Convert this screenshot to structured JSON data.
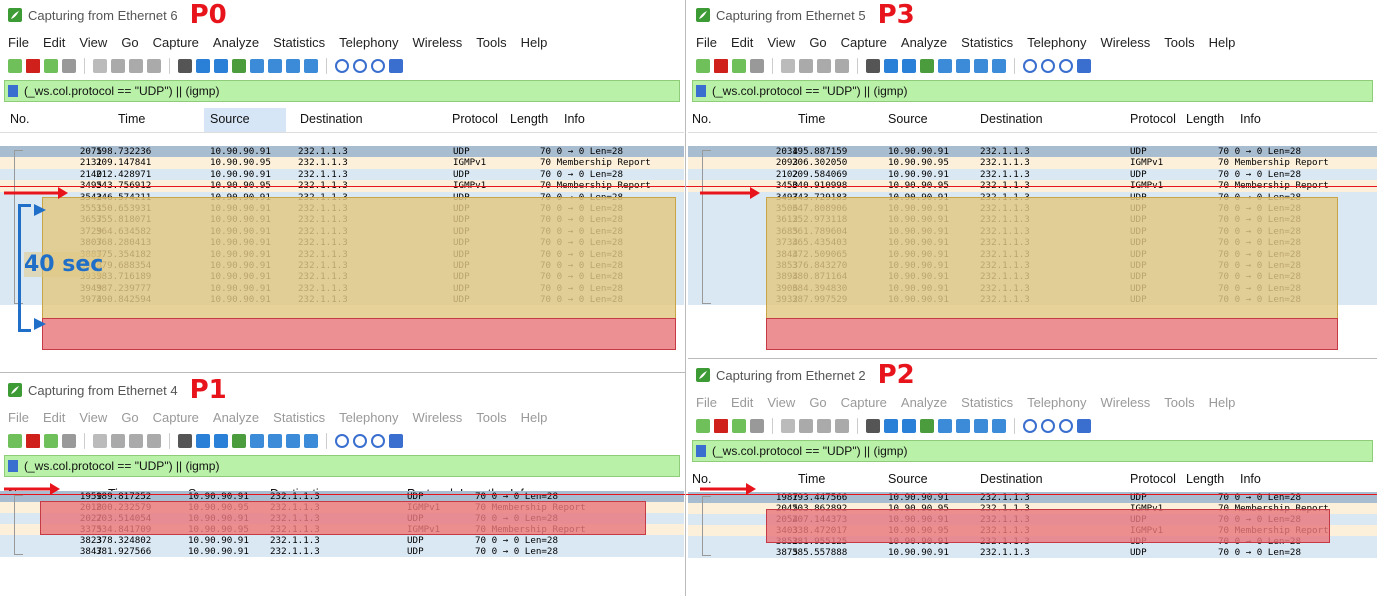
{
  "colors": {
    "filter_bg": "#b9f1a8",
    "udp_row": "#dae8f4",
    "igmp_row": "#fdf0da",
    "highlight_red": "#e97a7d",
    "highlight_yellow": "#e2c882",
    "accent_red": "#e8141c",
    "accent_blue": "#1f6ec8"
  },
  "menu": [
    "File",
    "Edit",
    "View",
    "Go",
    "Capture",
    "Analyze",
    "Statistics",
    "Telephony",
    "Wireless",
    "Tools",
    "Help"
  ],
  "filter": "(_ws.col.protocol == \"UDP\") || (igmp)",
  "columns": {
    "no": "No.",
    "time": "Time",
    "source": "Source",
    "destination": "Destination",
    "protocol": "Protocol",
    "length": "Length",
    "info": "Info"
  },
  "annotation_40sec": "40 sec",
  "panes": {
    "p0": {
      "title": "Capturing from Ethernet 6",
      "tag": "P0",
      "rows": [
        [
          "2075",
          "198.732236",
          "10.90.90.91",
          "232.1.1.3",
          "UDP",
          "70 0 → 0 Len=28"
        ],
        [
          "2131",
          "209.147841",
          "10.90.90.95",
          "232.1.1.3",
          "IGMPv1",
          "70 Membership Report"
        ],
        [
          "2140",
          "212.428971",
          "10.90.90.91",
          "232.1.1.3",
          "UDP",
          "70 0 → 0 Len=28"
        ],
        [
          "3495",
          "343.756912",
          "10.90.90.95",
          "232.1.1.3",
          "IGMPv1",
          "70 Membership Report"
        ],
        [
          "3542",
          "346.574211",
          "10.90.90.91",
          "232.1.1.3",
          "UDP",
          "70 0 → 0 Len=28"
        ],
        [
          "3551",
          "350.653931",
          "10.90.90.91",
          "232.1.1.3",
          "UDP",
          "70 0 → 0 Len=28"
        ],
        [
          "3657",
          "355.818071",
          "10.90.90.91",
          "232.1.1.3",
          "UDP",
          "70 0 → 0 Len=28"
        ],
        [
          "3729",
          "364.634582",
          "10.90.90.91",
          "232.1.1.3",
          "UDP",
          "70 0 → 0 Len=28"
        ],
        [
          "3807",
          "368.280413",
          "10.90.90.91",
          "232.1.1.3",
          "UDP",
          "70 0 → 0 Len=28"
        ],
        [
          "3887",
          "375.354182",
          "10.90.90.91",
          "232.1.1.3",
          "UDP",
          "70 0 → 0 Len=28"
        ],
        [
          "3898",
          "379.688354",
          "10.90.90.91",
          "232.1.1.3",
          "UDP",
          "70 0 → 0 Len=28"
        ],
        [
          "3939",
          "383.716189",
          "10.90.90.91",
          "232.1.1.3",
          "UDP",
          "70 0 → 0 Len=28"
        ],
        [
          "3949",
          "387.239777",
          "10.90.90.91",
          "232.1.1.3",
          "UDP",
          "70 0 → 0 Len=28"
        ],
        [
          "3974",
          "390.842594",
          "10.90.90.91",
          "232.1.1.3",
          "UDP",
          "70 0 → 0 Len=28"
        ]
      ]
    },
    "p3": {
      "title": "Capturing from Ethernet 5",
      "tag": "P3",
      "rows": [
        [
          "2034",
          "195.887159",
          "10.90.90.91",
          "232.1.1.3",
          "UDP",
          "70 0 → 0 Len=28"
        ],
        [
          "2093",
          "206.302050",
          "10.90.90.95",
          "232.1.1.3",
          "IGMPv1",
          "70 Membership Report"
        ],
        [
          "2102",
          "209.584069",
          "10.90.90.91",
          "232.1.1.3",
          "UDP",
          "70 0 → 0 Len=28"
        ],
        [
          "3450",
          "340.910998",
          "10.90.90.95",
          "232.1.1.3",
          "IGMPv1",
          "70 Membership Report"
        ],
        [
          "3497",
          "343.729183",
          "10.90.90.91",
          "232.1.1.3",
          "UDP",
          "70 0 → 0 Len=28"
        ],
        [
          "3506",
          "347.808906",
          "10.90.90.91",
          "232.1.1.3",
          "UDP",
          "70 0 → 0 Len=28"
        ],
        [
          "3612",
          "352.973118",
          "10.90.90.91",
          "232.1.1.3",
          "UDP",
          "70 0 → 0 Len=28"
        ],
        [
          "3685",
          "361.789604",
          "10.90.90.91",
          "232.1.1.3",
          "UDP",
          "70 0 → 0 Len=28"
        ],
        [
          "3734",
          "365.435403",
          "10.90.90.91",
          "232.1.1.3",
          "UDP",
          "70 0 → 0 Len=28"
        ],
        [
          "3844",
          "372.509065",
          "10.90.90.91",
          "232.1.1.3",
          "UDP",
          "70 0 → 0 Len=28"
        ],
        [
          "3853",
          "376.843270",
          "10.90.90.91",
          "232.1.1.3",
          "UDP",
          "70 0 → 0 Len=28"
        ],
        [
          "3894",
          "380.871164",
          "10.90.90.91",
          "232.1.1.3",
          "UDP",
          "70 0 → 0 Len=28"
        ],
        [
          "3906",
          "384.394830",
          "10.90.90.91",
          "232.1.1.3",
          "UDP",
          "70 0 → 0 Len=28"
        ],
        [
          "3932",
          "387.997529",
          "10.90.90.91",
          "232.1.1.3",
          "UDP",
          "70 0 → 0 Len=28"
        ]
      ]
    },
    "p1": {
      "title": "Capturing from Ethernet 4",
      "tag": "P1",
      "rows": [
        [
          "1959",
          "189.817252",
          "10.90.90.91",
          "232.1.1.3",
          "UDP",
          "70 0 → 0 Len=28"
        ],
        [
          "2018",
          "200.232579",
          "10.90.90.95",
          "232.1.1.3",
          "IGMPv1",
          "70 Membership Report"
        ],
        [
          "2027",
          "203.514054",
          "10.90.90.91",
          "232.1.1.3",
          "UDP",
          "70 0 → 0 Len=28"
        ],
        [
          "3375",
          "334.841709",
          "10.90.90.95",
          "232.1.1.3",
          "IGMPv1",
          "70 Membership Report"
        ],
        [
          "3823",
          "378.324802",
          "10.90.90.91",
          "232.1.1.3",
          "UDP",
          "70 0 → 0 Len=28"
        ],
        [
          "3847",
          "381.927566",
          "10.90.90.91",
          "232.1.1.3",
          "UDP",
          "70 0 → 0 Len=28"
        ]
      ]
    },
    "p2": {
      "title": "Capturing from Ethernet 2",
      "tag": "P2",
      "rows": [
        [
          "1987",
          "193.447566",
          "10.90.90.91",
          "232.1.1.3",
          "UDP",
          "70 0 → 0 Len=28"
        ],
        [
          "2045",
          "203.862892",
          "10.90.90.95",
          "232.1.1.3",
          "IGMPv1",
          "70 Membership Report"
        ],
        [
          "2054",
          "207.144373",
          "10.90.90.91",
          "232.1.1.3",
          "UDP",
          "70 0 → 0 Len=28"
        ],
        [
          "3403",
          "338.472017",
          "10.90.90.95",
          "232.1.1.3",
          "IGMPv1",
          "70 Membership Report"
        ],
        [
          "3852",
          "381.955125",
          "10.90.90.91",
          "232.1.1.3",
          "UDP",
          "70 0 → 0 Len=28"
        ],
        [
          "3875",
          "385.557888",
          "10.90.90.91",
          "232.1.1.3",
          "UDP",
          "70 0 → 0 Len=28"
        ]
      ]
    }
  }
}
